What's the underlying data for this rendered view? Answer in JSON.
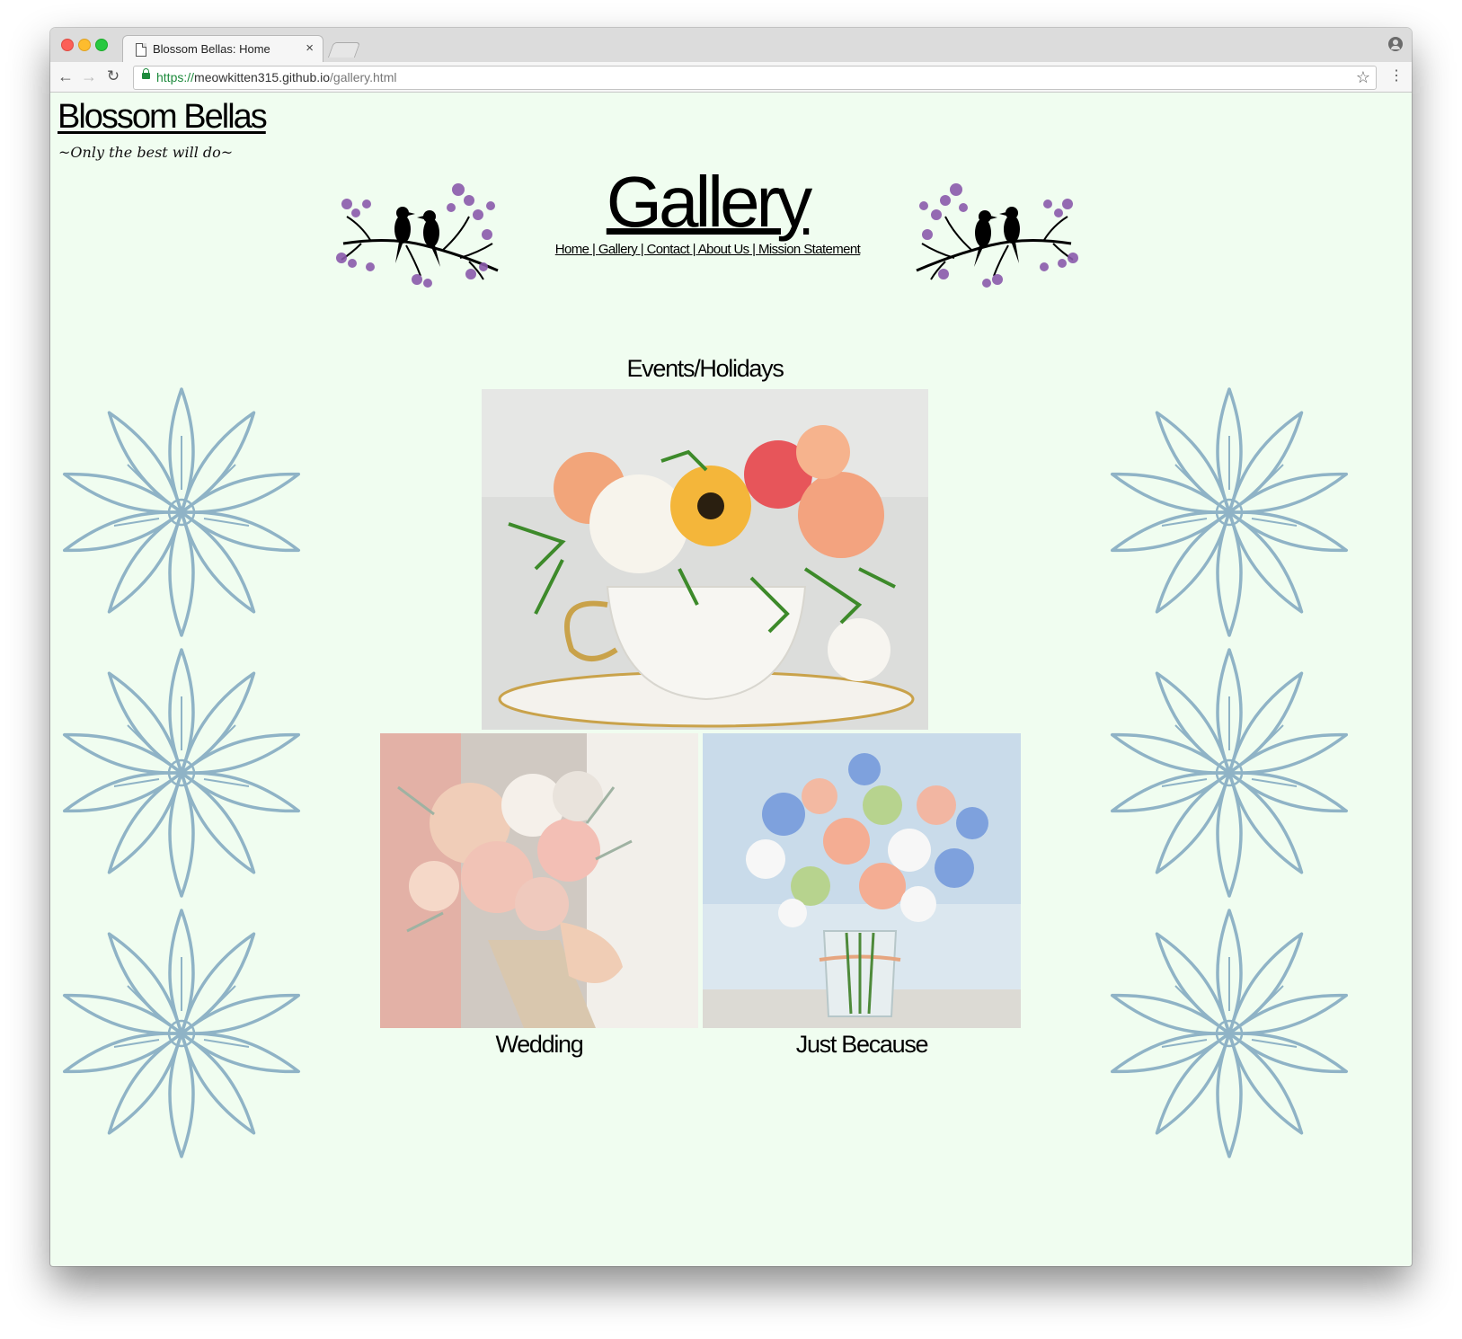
{
  "browser": {
    "tab_title": "Blossom Bellas: Home",
    "tab_close": "×",
    "url_scheme": "https://",
    "url_host": "meowkitten315.github.io",
    "url_path": "/gallery.html",
    "icons": [
      "back-arrow-icon",
      "forward-arrow-icon",
      "reload-icon",
      "lock-icon",
      "star-icon",
      "menu-icon",
      "profile-icon"
    ]
  },
  "site": {
    "brand": "Blossom Bellas",
    "tagline": "~Only the best will do~"
  },
  "header": {
    "title": "Gallery",
    "nav": [
      {
        "label": "Home"
      },
      {
        "label": "Gallery"
      },
      {
        "label": "Contact"
      },
      {
        "label": "About Us"
      },
      {
        "label": "Mission Statement"
      }
    ],
    "separator": " | "
  },
  "gallery": {
    "events_label": "Events/Holidays",
    "wedding_label": "Wedding",
    "just_because_label": "Just Because"
  },
  "colors": {
    "page_bg": "#f0fdf0",
    "flower_outline": "#8fb3c6",
    "blossom": "#8a5aab",
    "photo_bg_1": "#d9dad8",
    "photo_bg_2": "#cfd6db",
    "photo_bg_3": "#c9dbea"
  }
}
